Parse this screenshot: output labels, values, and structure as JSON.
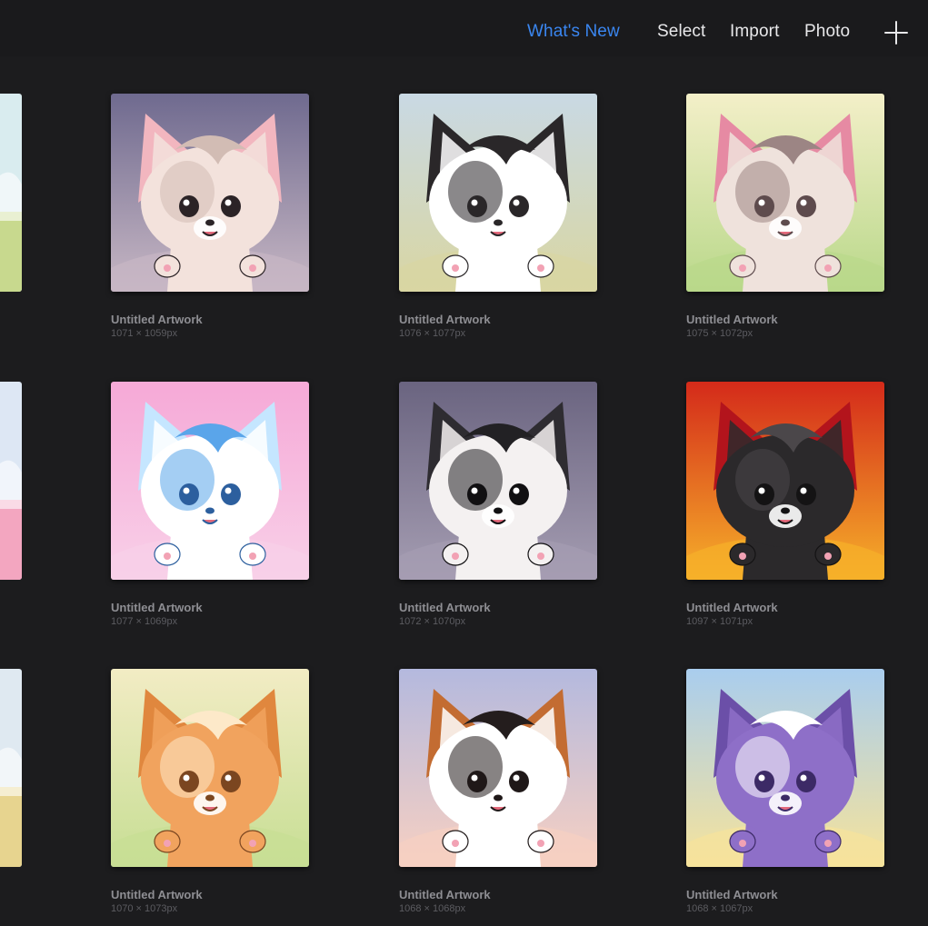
{
  "topbar": {
    "whats_new": "What's New",
    "select": "Select",
    "import": "Import",
    "photo": "Photo",
    "add_icon": "plus-icon",
    "accent_color": "#3a86f0"
  },
  "gallery": {
    "items": [
      {
        "title": "Untitled Artwork",
        "dims": "1071 × 1059px",
        "bg": "#6f6a8f",
        "bg2": "#c7b7c4",
        "fur": "#f3e2dc",
        "patch": "#d2bcb4",
        "ear": "#f2b6bf",
        "dark": "#2b2326"
      },
      {
        "title": "Untitled Artwork",
        "dims": "1076 × 1077px",
        "bg": "#c9d9e4",
        "bg2": "#d9d6a2",
        "fur": "#ffffff",
        "patch": "#2a2729",
        "ear": "#2a2729",
        "dark": "#2a2729"
      },
      {
        "title": "Untitled Artwork",
        "dims": "1075 × 1072px",
        "bg": "#f3efc8",
        "bg2": "#b9d88a",
        "fur": "#efe2dc",
        "patch": "#9c8584",
        "ear": "#e68aa3",
        "dark": "#5e4b4d"
      },
      {
        "title": "Untitled Artwork",
        "dims": "1077 × 1069px",
        "bg": "#f6a9d7",
        "bg2": "#f8d0e8",
        "fur": "#ffffff",
        "patch": "#5aa5ea",
        "ear": "#c5e6ff",
        "dark": "#2c5f9e"
      },
      {
        "title": "Untitled Artwork",
        "dims": "1072 × 1070px",
        "bg": "#6a6480",
        "bg2": "#a59db2",
        "fur": "#f4f1f1",
        "patch": "#222124",
        "ear": "#2e2c31",
        "dark": "#111012"
      },
      {
        "title": "Untitled Artwork",
        "dims": "1097 × 1071px",
        "bg": "#d42a1a",
        "bg2": "#f6b02a",
        "fur": "#2b292b",
        "patch": "#4b474a",
        "ear": "#b3141c",
        "dark": "#141314"
      },
      {
        "title": "Untitled Artwork",
        "dims": "1070 × 1073px",
        "bg": "#f2ecc4",
        "bg2": "#c7de94",
        "fur": "#f1a35e",
        "patch": "#fde9c9",
        "ear": "#e0873e",
        "dark": "#7b4620"
      },
      {
        "title": "Untitled Artwork",
        "dims": "1068 × 1068px",
        "bg": "#b4b9de",
        "bg2": "#f7d0c2",
        "fur": "#ffffff",
        "patch": "#241d1d",
        "ear": "#c36c32",
        "dark": "#1f1818"
      },
      {
        "title": "Untitled Artwork",
        "dims": "1068 × 1067px",
        "bg": "#a9cdee",
        "bg2": "#f6e39b",
        "fur": "#8e6fc8",
        "patch": "#ffffff",
        "ear": "#6b4fa8",
        "dark": "#3c2a66"
      }
    ],
    "edge_items": [
      {
        "bg": "#d9ecef",
        "bg2": "#c8d98e"
      },
      {
        "bg": "#dde7f4",
        "bg2": "#f3a6c0"
      },
      {
        "bg": "#dfe9f1",
        "bg2": "#e7d48f"
      }
    ]
  }
}
